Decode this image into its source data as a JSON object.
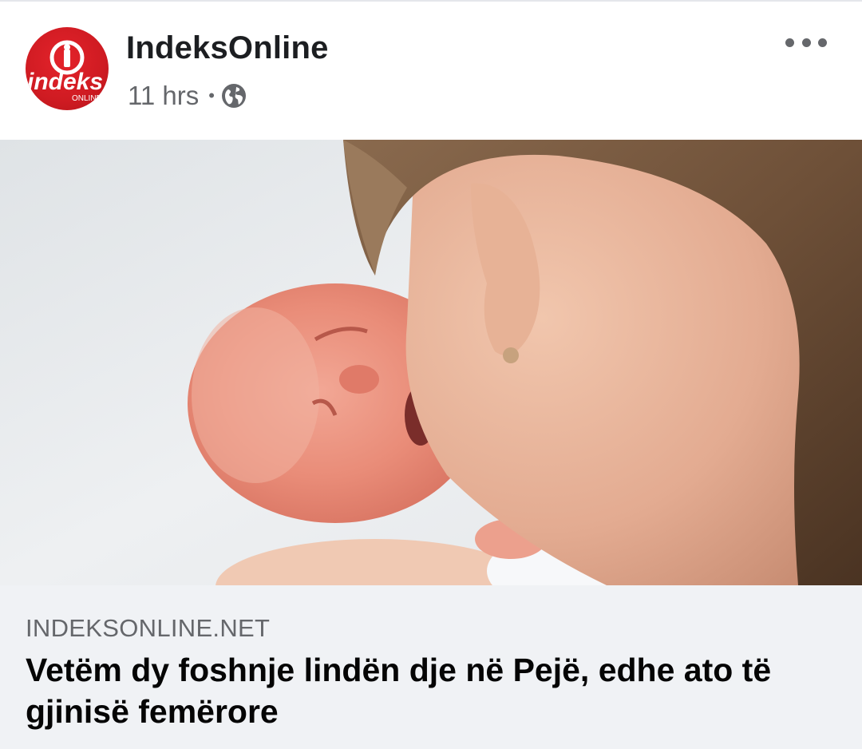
{
  "post": {
    "page_name": "IndeksOnline",
    "time": "11 hrs",
    "separator": "•",
    "audience_icon": "globe-icon",
    "more_icon": "more-horizontal-icon",
    "avatar": {
      "logo_text": "indeks",
      "logo_subtext": "ONLINE",
      "brand_color": "#d71f26"
    }
  },
  "photo": {
    "description_icon": "photo"
  },
  "link": {
    "domain": "INDEKSONLINE.NET",
    "headline": "Vetëm dy foshnje lindën dje në Pejë, edhe ato të gjinisë femërore"
  },
  "colors": {
    "text_primary": "#1c1e21",
    "text_secondary": "#65676b",
    "preview_bg": "#f0f2f5",
    "brand_red": "#d71f26"
  }
}
